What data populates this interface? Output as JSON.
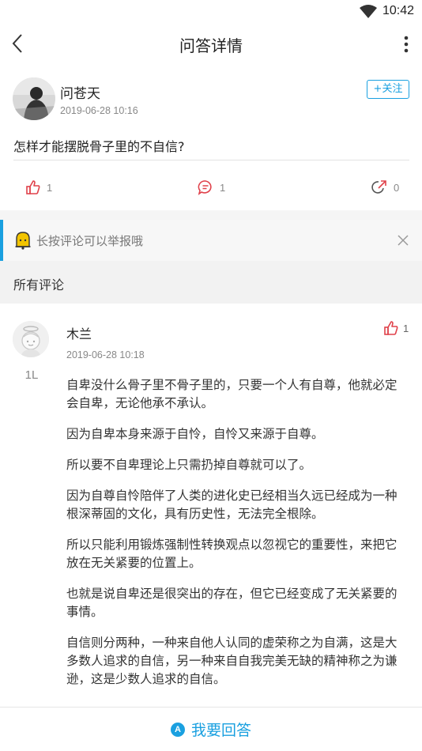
{
  "status_bar": {
    "time": "10:42",
    "wifi_icon": "wifi-icon"
  },
  "app_bar": {
    "title": "问答详情",
    "back_icon": "back-arrow-icon",
    "more_icon": "more-vertical-icon"
  },
  "post": {
    "author": "问苍天",
    "time": "2019-06-28 10:16",
    "follow_label": "+关注",
    "question": "怎样才能摆脱骨子里的不自信?",
    "likes": "1",
    "comments": "1",
    "shares": "0"
  },
  "notice": {
    "text": "长按评论可以举报哦",
    "close_icon": "close-icon"
  },
  "section": {
    "title": "所有评论"
  },
  "comment": {
    "name": "木兰",
    "time": "2019-06-28 10:18",
    "floor": "1L",
    "likes": "1",
    "paragraphs": [
      "自卑没什么骨子里不骨子里的，只要一个人有自尊，他就必定会自卑，无论他承不承认。",
      "因为自卑本身来源于自怜，自怜又来源于自尊。",
      "所以要不自卑理论上只需扔掉自尊就可以了。",
      "因为自尊自怜陪伴了人类的进化史已经相当久远已经成为一种根深蒂固的文化，具有历史性，无法完全根除。",
      "所以只能利用锻炼强制性转换观点以忽视它的重要性，来把它放在无关紧要的位置上。",
      "也就是说自卑还是很突出的存在，但它已经变成了无关紧要的事情。",
      "自信则分两种，一种来自他人认同的虚荣称之为自满，这是大多数人追求的自信，另一种来自自我完美无缺的精神称之为谦逊，这是少数人追求的自信。"
    ]
  },
  "bottom": {
    "answer_label": "我要回答",
    "answer_icon_letter": "A"
  },
  "colors": {
    "accent": "#1aa0e0",
    "like_red": "#e0424b",
    "notice_yellow": "#f2c400"
  }
}
